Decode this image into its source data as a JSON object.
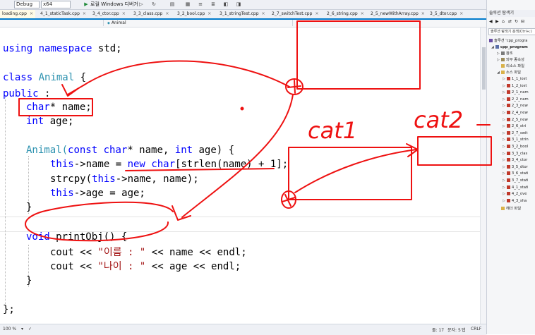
{
  "toolbar": {
    "config": "Debug",
    "platform": "x64",
    "run_label": "로컬 Windows 디버거"
  },
  "tabs": [
    "loading.cpp",
    "4_1_staticTask.cpp",
    "3_4_ctor.cpp",
    "3_3_class.cpp",
    "3_2_bool.cpp",
    "3_1_stringTest.cpp",
    "2_7_switchTest.cpp",
    "2_6_string.cpp",
    "2_5_newWithArray.cpp",
    "3_5_dtor.cpp"
  ],
  "navbar": {
    "scope": "",
    "class": "Animal"
  },
  "code": {
    "l1_kw1": "using",
    "l1_kw2": "namespace",
    "l1_rest": " std;",
    "l2_kw": "class",
    "l2_ty": "Animal",
    "l2_rest": " {",
    "l3_kw": "public",
    "l3_rest": " :",
    "l4_kw": "char",
    "l4_rest": "* name;",
    "l5_kw": "int",
    "l5_rest": " age;",
    "l6_name": "Animal(",
    "l6_kw1": "const",
    "l6_kw2": "char",
    "l6_mid": "* name, ",
    "l6_kw3": "int",
    "l6_rest": " age) {",
    "l7_kw": "this",
    "l7_mid": "->name = ",
    "l7_kw2": "new",
    "l7_kw3": "char",
    "l7_rest": "[strlen(name) + 1];",
    "l8_pre": "strcpy(",
    "l8_kw": "this",
    "l8_rest": "->name, name);",
    "l9_kw": "this",
    "l9_rest": "->age = age;",
    "l10": "}",
    "l11_kw": "void",
    "l11_rest": " printObj() {",
    "l12_pre": "cout << ",
    "l12_str": "\"이름 : \"",
    "l12_rest": " << name << endl;",
    "l13_pre": "cout << ",
    "l13_str": "\"나이 : \"",
    "l13_rest": " << age << endl;",
    "l14": "}",
    "l15": "};"
  },
  "handwriting": {
    "label1": "cat1",
    "label2": "cat2"
  },
  "statusbar": {
    "zoom": "100 %",
    "line": "줄: 17",
    "char": "문자: 5",
    "tab": "탭",
    "eol": "CRLF"
  },
  "solution": {
    "title": "솔루션 탐색기",
    "search": "솔루션 탐색기 검색(Ctrl+;)",
    "solution_node": "솔루션 'cpp_progra",
    "project": "cpp_program",
    "refs": "참조",
    "external": "외부 종속성",
    "resources": "리소스 파일",
    "sources": "소스 파일",
    "files": [
      "1_1_iost",
      "1_2_iost",
      "2_1_nam",
      "2_2_nam",
      "2_3_new",
      "2_4_new",
      "2_5_new",
      "2_6_stri",
      "2_7_swit",
      "3_1_strin",
      "3_2_bool",
      "3_3_clas",
      "3_4_ctor",
      "3_5_dtor",
      "3_6_stati",
      "3_7_stati",
      "4_1_stati",
      "4_2_ove",
      "4_3_sha"
    ],
    "headers": "헤더 파일"
  },
  "colors": {
    "keyword": "#0000ff",
    "type": "#2b91af",
    "string": "#a31515",
    "pen": "#ee1111",
    "accent": "#007acc"
  }
}
